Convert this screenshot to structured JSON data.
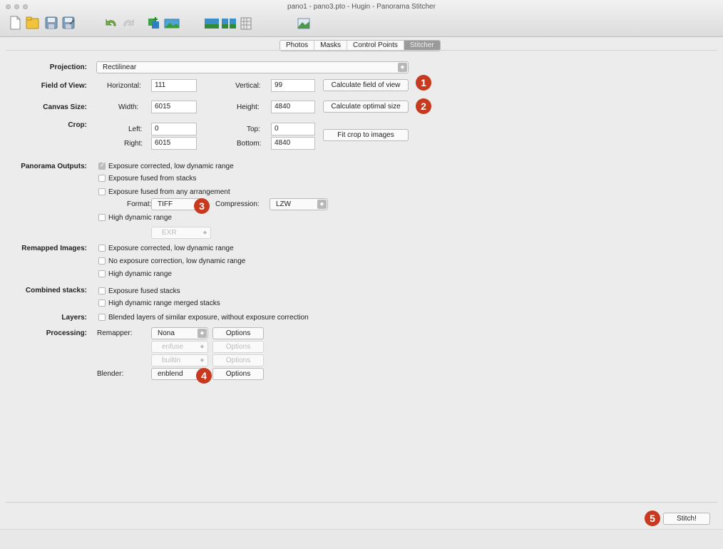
{
  "window": {
    "title": "pano1 - pano3.pto - Hugin - Panorama Stitcher"
  },
  "toolbar": {
    "icons": [
      "new-document-icon",
      "open-folder-icon",
      "save-icon",
      "save-as-icon",
      "undo-icon",
      "redo-icon",
      "add-images-icon",
      "fast-preview-icon",
      "align-icon",
      "images-grid-icon",
      "layout-icon",
      "preview-icon"
    ]
  },
  "tabs": [
    "Photos",
    "Masks",
    "Control Points",
    "Stitcher"
  ],
  "active_tab": "Stitcher",
  "projection": {
    "label": "Projection:",
    "value": "Rectilinear"
  },
  "fov": {
    "label": "Field of View:",
    "h_label": "Horizontal:",
    "h_value": "111",
    "v_label": "Vertical:",
    "v_value": "99",
    "button": "Calculate field of view"
  },
  "canvas": {
    "label": "Canvas Size:",
    "w_label": "Width:",
    "w_value": "6015",
    "h_label": "Height:",
    "h_value": "4840",
    "button": "Calculate optimal size"
  },
  "crop": {
    "label": "Crop:",
    "left_label": "Left:",
    "left_value": "0",
    "top_label": "Top:",
    "top_value": "0",
    "right_label": "Right:",
    "right_value": "6015",
    "bottom_label": "Bottom:",
    "bottom_value": "4840",
    "button": "Fit crop to images"
  },
  "outputs": {
    "label": "Panorama Outputs:",
    "opt1": "Exposure corrected, low dynamic range",
    "opt1_checked": true,
    "opt2": "Exposure fused from stacks",
    "opt3": "Exposure fused from any arrangement",
    "format_label": "Format:",
    "format_value": "TIFF",
    "compression_label": "Compression:",
    "compression_value": "LZW",
    "hdr": "High dynamic range",
    "hdr_format": "EXR"
  },
  "remapped": {
    "label": "Remapped Images:",
    "opt1": "Exposure corrected, low dynamic range",
    "opt2": "No exposure correction, low dynamic range",
    "opt3": "High dynamic range"
  },
  "combined": {
    "label": "Combined stacks:",
    "opt1": "Exposure fused stacks",
    "opt2": "High dynamic range merged stacks"
  },
  "layers": {
    "label": "Layers:",
    "opt1": "Blended layers of similar exposure, without exposure correction"
  },
  "processing": {
    "label": "Processing:",
    "remapper_label": "Remapper:",
    "remapper_value": "Nona",
    "options": "Options",
    "fuser_value": "enfuse",
    "hdr_merger_value": "builtin",
    "blender_label": "Blender:",
    "blender_value": "enblend"
  },
  "stitch_button": "Stitch!",
  "markers": [
    "1",
    "2",
    "3",
    "4",
    "5"
  ],
  "colors": {
    "marker": "#c83a1f",
    "active_tab": "#9a9a9a"
  }
}
